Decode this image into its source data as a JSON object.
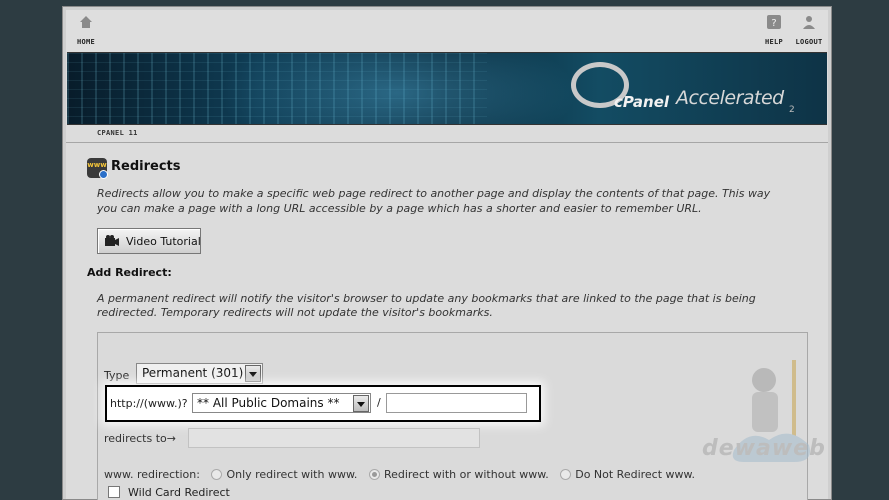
{
  "topnav": {
    "home": "HOME",
    "help": "HELP",
    "logout": "LOGOUT"
  },
  "banner": {
    "brand": "cPanel",
    "tagline": "Accelerated",
    "version": "2"
  },
  "breadcrumb": "CPANEL 11",
  "page": {
    "title": "Redirects",
    "icon": "www-icon",
    "description": "Redirects allow you to make a specific web page redirect to another page and display the contents of that page. This way you can make a page with a long URL accessible by a page which has a shorter and easier to remember URL.",
    "video_button": "Video Tutorial"
  },
  "add_redirect": {
    "title": "Add Redirect:",
    "description": "A permanent redirect will notify the visitor's browser to update any bookmarks that are linked to the page that is being redirected. Temporary redirects will not update the visitor's bookmarks.",
    "type_label": "Type",
    "type_value": "Permanent (301)",
    "http_label": "http://(www.)?",
    "domain_value": "** All Public Domains **",
    "slash": "/",
    "path_value": "",
    "redirects_to_label": "redirects to→",
    "redirects_to_value": "",
    "www_label": "www. redirection:",
    "www_options": [
      "Only redirect with www.",
      "Redirect with or without www.",
      "Do Not Redirect www."
    ],
    "www_selected": "Redirect with or without www.",
    "wildcard_label": "Wild Card Redirect"
  },
  "watermark_text": "dewaweb"
}
